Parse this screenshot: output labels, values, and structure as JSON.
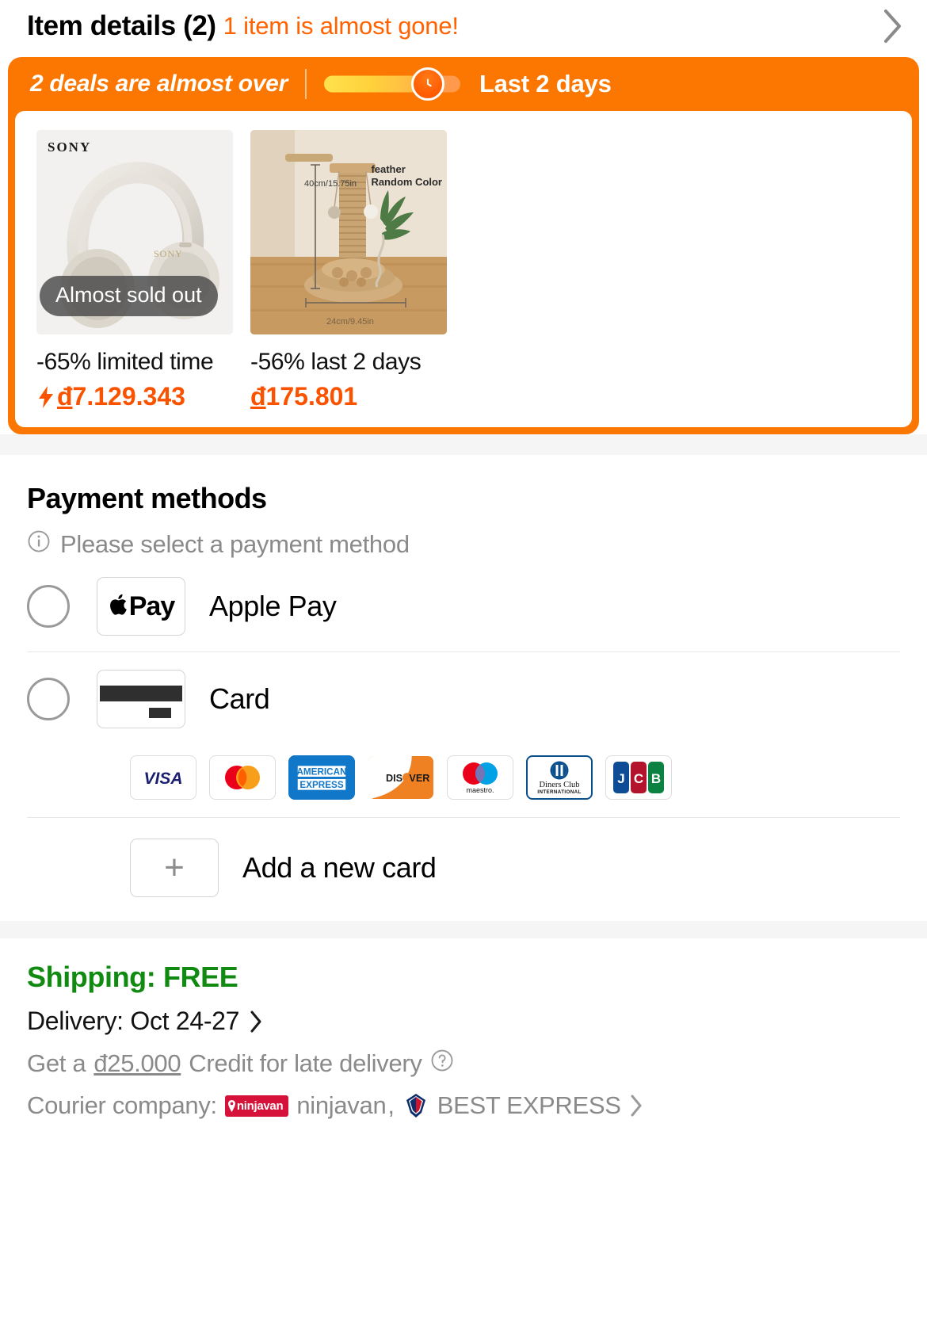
{
  "item_header": {
    "title": "Item details (2)",
    "subtitle": "1 item is almost gone!",
    "chevron_icon": "chevron-right-icon"
  },
  "deals_banner": {
    "headline": "2 deals are almost over",
    "countdown_label": "Last 2 days",
    "timer_icon": "clock-icon",
    "progress_percent": 74,
    "bg_color": "#fb7701"
  },
  "deals": [
    {
      "image_alt": "sony-headphones",
      "brand_mark": "SONY",
      "badge": "Almost sold out",
      "discount": "-65% limited time",
      "price": "7.129.343",
      "currency": "đ",
      "flash_icon": "bolt-icon",
      "price_color": "#fb5200"
    },
    {
      "image_alt": "cat-scratching-post",
      "image_text_1": "feather",
      "image_text_2": "Random Color",
      "image_dim_vertical": "40cm/15.75in",
      "image_dim_horizontal": "24cm/9.45in",
      "badge": "",
      "discount": "-56% last 2 days",
      "price": "175.801",
      "currency": "đ",
      "price_color": "#fb5200"
    }
  ],
  "payment": {
    "title": "Payment methods",
    "note": "Please select a payment method",
    "note_icon": "info-icon",
    "methods": [
      {
        "id": "apple-pay",
        "label": "Apple Pay",
        "logo": "apple-pay-logo",
        "logo_text": "Pay",
        "selected": false
      },
      {
        "id": "card",
        "label": "Card",
        "logo": "credit-card-icon",
        "selected": false
      }
    ],
    "card_brands": [
      {
        "name": "visa",
        "label": "VISA"
      },
      {
        "name": "mastercard",
        "label": ""
      },
      {
        "name": "american-express",
        "label_1": "AMERICAN",
        "label_2": "EXPRESS"
      },
      {
        "name": "discover",
        "label": "DISC VER"
      },
      {
        "name": "maestro",
        "label": "maestro."
      },
      {
        "name": "diners-club",
        "label_1": "Diners Club",
        "label_2": "INTERNATIONAL"
      },
      {
        "name": "jcb",
        "label": "JCB"
      }
    ],
    "add_card": {
      "label": "Add a new card",
      "icon": "plus-icon"
    }
  },
  "shipping": {
    "shipping_label": "Shipping: FREE",
    "shipping_color": "#118a11",
    "delivery_label": "Delivery: Oct 24-27",
    "delivery_chevron": "chevron-right-icon",
    "credit_prefix": "Get a",
    "credit_amount": "đ25.000",
    "credit_suffix": "Credit for late delivery",
    "credit_help_icon": "question-circle-icon",
    "courier_label": "Courier company:",
    "courier_1_name": "ninjavan",
    "courier_1_logo_text": "ninjavan",
    "courier_1_separator": ",",
    "courier_2_name": "BEST EXPRESS",
    "courier_chevron": "chevron-right-icon"
  }
}
